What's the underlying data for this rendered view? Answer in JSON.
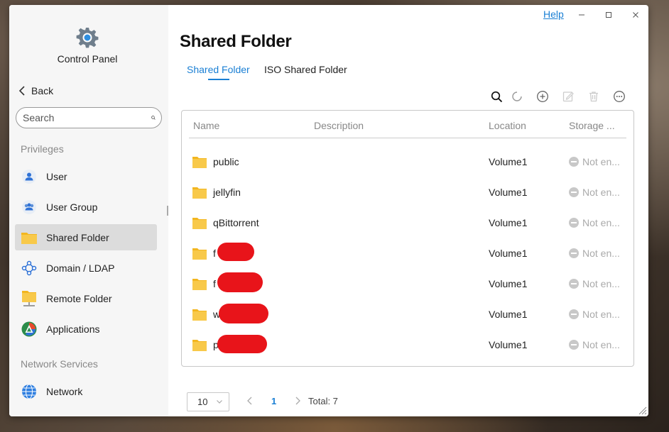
{
  "window": {
    "help_label": "Help",
    "minimize": "–",
    "maximize": "□",
    "close": "✕"
  },
  "sidebar": {
    "app_title": "Control Panel",
    "back_label": "Back",
    "search_placeholder": "Search",
    "sections": [
      {
        "label": "Privileges",
        "items": [
          {
            "label": "User",
            "icon": "user-icon"
          },
          {
            "label": "User Group",
            "icon": "user-group-icon"
          },
          {
            "label": "Shared Folder",
            "icon": "folder-icon",
            "active": true
          },
          {
            "label": "Domain / LDAP",
            "icon": "domain-icon"
          },
          {
            "label": "Remote Folder",
            "icon": "remote-folder-icon"
          },
          {
            "label": "Applications",
            "icon": "applications-icon"
          }
        ]
      },
      {
        "label": "Network Services",
        "items": [
          {
            "label": "Network",
            "icon": "globe-icon"
          }
        ]
      }
    ]
  },
  "main": {
    "title": "Shared Folder",
    "tabs": [
      {
        "label": "Shared Folder",
        "active": true
      },
      {
        "label": "ISO Shared Folder",
        "active": false
      }
    ],
    "toolbar": [
      "search-icon",
      "refresh-icon",
      "add-icon",
      "edit-icon",
      "delete-icon",
      "more-icon"
    ],
    "table": {
      "columns": [
        "Name",
        "Description",
        "Location",
        "Storage ..."
      ],
      "rows": [
        {
          "name": "public",
          "description": "",
          "location": "Volume1",
          "storage": "Not en..."
        },
        {
          "name": "jellyfin",
          "description": "",
          "location": "Volume1",
          "storage": "Not en..."
        },
        {
          "name": "qBittorrent",
          "description": "",
          "location": "Volume1",
          "storage": "Not en..."
        },
        {
          "name": "f",
          "description": "",
          "location": "Volume1",
          "storage": "Not en..."
        },
        {
          "name": "f",
          "description": "",
          "location": "Volume1",
          "storage": "Not en..."
        },
        {
          "name": "w",
          "description": "",
          "location": "Volume1",
          "storage": "Not en..."
        },
        {
          "name": "p",
          "description": "",
          "location": "Volume1",
          "storage": "Not en..."
        }
      ]
    },
    "pager": {
      "page_size": "10",
      "current_page": "1",
      "total_label": "Total: 7"
    }
  },
  "colors": {
    "accent": "#1a7fd4",
    "folder": "#f6c12c",
    "redaction": "#e8141a"
  }
}
